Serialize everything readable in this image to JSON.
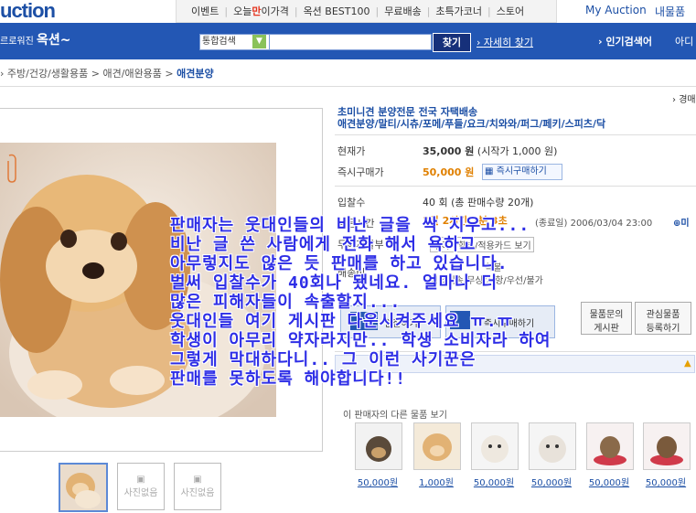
{
  "header": {
    "logo": "uction",
    "menu": [
      "이벤트",
      "오늘만이가격",
      "옥션 BEST100",
      "무료배송",
      "초특가코너",
      "스토어"
    ],
    "my_auction": "My Auction",
    "my_purchase": "내물품",
    "slogan_small": "르로워진",
    "slogan_big": "옥션~"
  },
  "search": {
    "category": "통합검색",
    "button": "찾기",
    "detail": "자세히 찾기",
    "popular": "인기검색어",
    "next": "아디"
  },
  "breadcrumb": {
    "items": [
      "주방/건강/생활용품",
      "애견/애완용품"
    ],
    "current": "애견분양"
  },
  "product": {
    "tag": "경매",
    "title_line1": "초미니견 분양전문 전국 자택배송",
    "title_line2": "애견분양/말티/시츄/포메/푸들/요크/치와와/퍼그/페키/스피츠/닥",
    "current_price_label": "현재가",
    "current_price": "35,000 원",
    "start_price": "(시작가 1,000 원)",
    "instant_label": "즉시구매가",
    "instant_price": "50,000 원",
    "instant_button": "즉시구매하기",
    "bid_count_label": "입찰수",
    "bid_count": "40 회 (총 판매수량 20개)",
    "time_label": "남은시간",
    "time_value": "3일 2시간 2분 3초",
    "end_time": "(종료일) 2006/03/04 23:00",
    "more": "미",
    "payment_label": "무이자할부",
    "payment_value": "무이자할부/적용카드 보기",
    "delivery_label": "배송비",
    "delivery_value": "착불",
    "delivery_note": "직접배송/무상/사항/우선/불가"
  },
  "actions": {
    "bid": "입찰하기",
    "buy": "즉시구매하기",
    "qna_line1": "물품문의",
    "qna_line2": "게시판",
    "interest_line1": "관심물품",
    "interest_line2": "등록하기"
  },
  "thumbs": {
    "no_photo": "사진없음"
  },
  "other": {
    "seller_label": "이 판매자의 다른 물품 보기",
    "prices": [
      "50,000원",
      "1,000원",
      "50,000원",
      "50,000원",
      "50,000원",
      "50,000원"
    ]
  },
  "overlay": {
    "lines": [
      "판매자는 웃대인들의 비난 글을 싹 지우고...",
      "비난 글 쓴 사람에게 전화 해서 욕하고",
      "아무렇지도 않은 듯 판매를 하고 있습니다.",
      "벌써 입찰수가 40회나 됐네요. 얼마나 더",
      "많은 피해자들이 속출할지...",
      "웃대인들 여기 게시판 다운시켜주세요 ㅠ.ㅠ",
      "학생이 아무리 약자라지만.. 학생 소비자라 하여",
      "그렇게 막대하다니.. 그 이런 사기꾼은",
      "판매를 못하도록 해야합니다!!"
    ]
  }
}
